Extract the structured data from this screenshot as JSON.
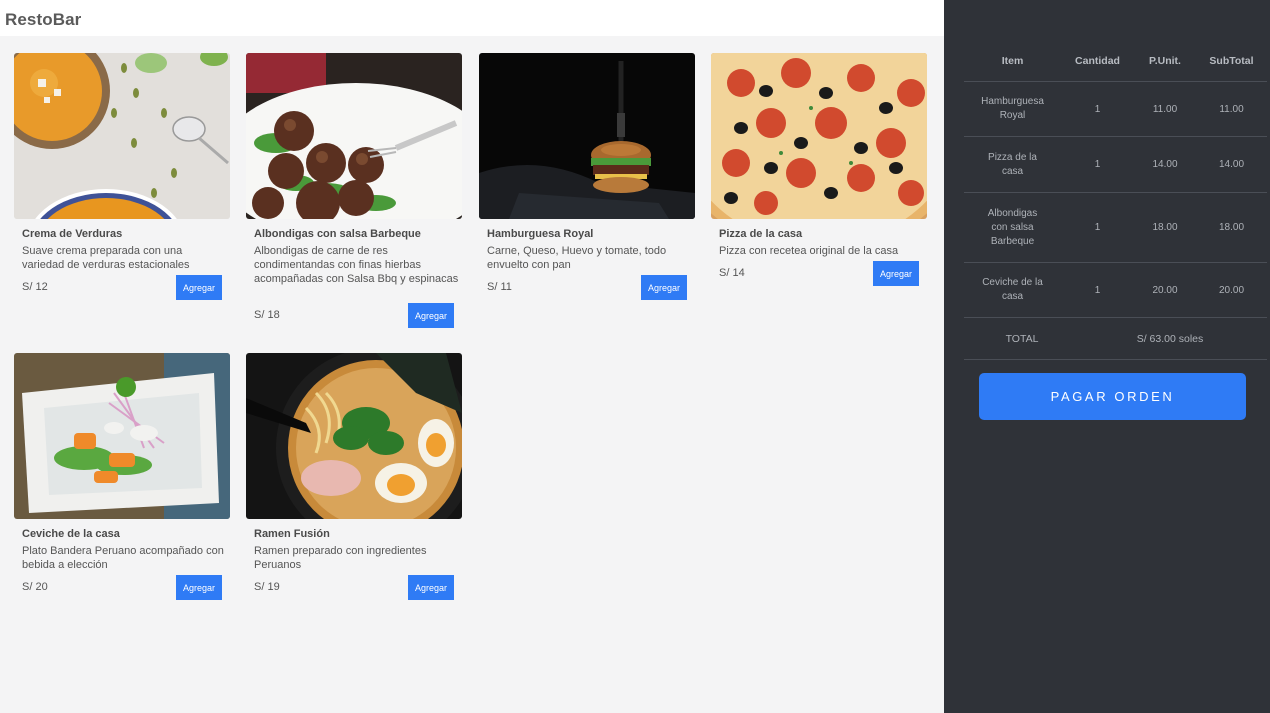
{
  "app": {
    "brand": "RestoBar"
  },
  "menu": {
    "add_label": "Agregar",
    "items": [
      {
        "name": "Crema de Verduras",
        "description": "Suave crema preparada con una variedad de verduras estacionales",
        "price": "S/ 12",
        "image": "soup-photo"
      },
      {
        "name": "Albondigas con salsa Barbeque",
        "description": "Albondigas de carne de res condimentandas con finas hierbas acompañadas con Salsa Bbq y espinacas",
        "price": "S/ 18",
        "image": "meatballs-photo"
      },
      {
        "name": "Hamburguesa Royal",
        "description": "Carne, Queso, Huevo y tomate, todo envuelto con pan",
        "price": "S/ 11",
        "image": "burger-photo"
      },
      {
        "name": "Pizza de la casa",
        "description": "Pizza con recetea original de la casa",
        "price": "S/ 14",
        "image": "pizza-photo"
      },
      {
        "name": "Ceviche de la casa",
        "description": "Plato Bandera Peruano acompañado con bebida a elección",
        "price": "S/ 20",
        "image": "ceviche-photo"
      },
      {
        "name": "Ramen Fusión",
        "description": "Ramen preparado con ingredientes Peruanos",
        "price": "S/ 19",
        "image": "ramen-photo"
      }
    ]
  },
  "order": {
    "headers": {
      "item": "Item",
      "qty": "Cantidad",
      "unit": "P.Unit.",
      "subtotal": "SubTotal"
    },
    "rows": [
      {
        "item": "Hamburguesa Royal",
        "qty": "1",
        "unit": "11.00",
        "subtotal": "11.00"
      },
      {
        "item": "Pizza de la casa",
        "qty": "1",
        "unit": "14.00",
        "subtotal": "14.00"
      },
      {
        "item": "Albondigas con salsa Barbeque",
        "qty": "1",
        "unit": "18.00",
        "subtotal": "18.00"
      },
      {
        "item": "Ceviche de la casa",
        "qty": "1",
        "unit": "20.00",
        "subtotal": "20.00"
      }
    ],
    "total_label": "TOTAL",
    "total_value": "S/ 63.00 soles",
    "pay_label": "PAGAR ORDEN"
  },
  "colors": {
    "accent": "#2f7bf5",
    "sidebar": "#2f3238",
    "background": "#f4f4f5"
  }
}
